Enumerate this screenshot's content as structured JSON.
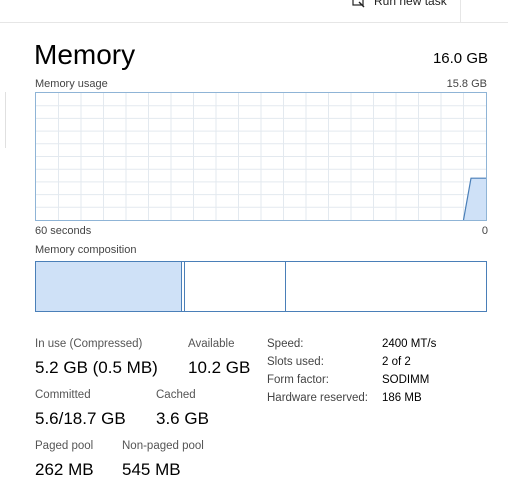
{
  "toolbar": {
    "run_task_label": "Run new task"
  },
  "header": {
    "title": "Memory",
    "total": "16.0 GB"
  },
  "usage_graph": {
    "label": "Memory usage",
    "max_label": "15.8 GB",
    "left_time_label": "60 seconds",
    "right_time_label": "0",
    "history_in_use_gb": [
      0,
      0,
      0,
      0,
      0,
      0,
      0,
      0,
      0,
      0,
      0,
      0,
      0,
      0,
      0,
      0,
      0,
      0,
      0,
      0,
      0,
      0,
      0,
      0,
      0,
      0,
      0,
      0,
      0,
      0,
      0,
      0,
      0,
      0,
      0,
      0,
      0,
      0,
      0,
      0,
      0,
      0,
      0,
      0,
      0,
      0,
      0,
      0,
      0,
      0,
      0,
      0,
      0,
      0,
      0,
      0,
      0,
      0,
      5.2,
      5.2,
      5.2
    ]
  },
  "composition": {
    "label": "Memory composition",
    "segments": [
      {
        "name": "in-use",
        "value_gb": 5.2
      },
      {
        "name": "modified",
        "value_gb": 0.1
      },
      {
        "name": "standby",
        "value_gb": 3.6
      },
      {
        "name": "free",
        "value_gb": 6.9
      }
    ]
  },
  "stats": {
    "in_use_label": "In use (Compressed)",
    "in_use_value": "5.2 GB (0.5 MB)",
    "available_label": "Available",
    "available_value": "10.2 GB",
    "committed_label": "Committed",
    "committed_value": "5.6/18.7 GB",
    "cached_label": "Cached",
    "cached_value": "3.6 GB",
    "paged_pool_label": "Paged pool",
    "paged_pool_value": "262 MB",
    "non_paged_pool_label": "Non-paged pool",
    "non_paged_pool_value": "545 MB"
  },
  "specs": [
    {
      "key": "Speed:",
      "value": "2400 MT/s"
    },
    {
      "key": "Slots used:",
      "value": "2 of 2"
    },
    {
      "key": "Form factor:",
      "value": "SODIMM"
    },
    {
      "key": "Hardware reserved:",
      "value": "186 MB"
    }
  ],
  "colors": {
    "accent_border": "#4a7fb8",
    "graph_border": "#8fb4d6",
    "fill": "#cfe1f7",
    "grid": "#e3e9ef"
  }
}
